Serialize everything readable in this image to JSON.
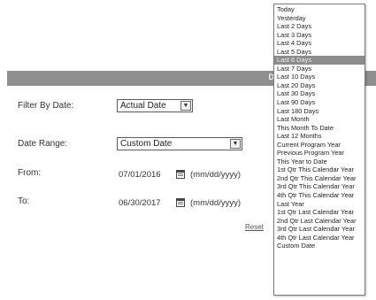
{
  "banner": {
    "text": "De"
  },
  "filter": {
    "filter_label": "Filter By Date:",
    "filter_value": "Actual Date",
    "range_label": "Date Range:",
    "range_value": "Custom Date",
    "from_label": "From:",
    "from_value": "07/01/2016",
    "to_label": "To:",
    "to_value": "06/30/2017",
    "date_hint": "(mm/dd/yyyy)",
    "reset_label": "Reset"
  },
  "dropdown": {
    "selected_index": 6,
    "options": [
      "Today",
      "Yesterday",
      "Last 2 Days",
      "Last 3 Days",
      "Last 4 Days",
      "Last 5 Days",
      "Last 6 Days",
      "Last 7 Days",
      "Last 10 Days",
      "Last 20 Days",
      "Last 30 Days",
      "Last 90 Days",
      "Last 180 Days",
      "Last Month",
      "This Month To Date",
      "Last 12 Months",
      "Current Program Year",
      "Previous Program Year",
      "This Year to Date",
      "1st Qtr This Calendar Year",
      "2nd Qtr This Calendar Year",
      "3rd Qtr This Calendar Year",
      "4th Qtr This Calendar Year",
      "Last Year",
      "1st Qtr Last Calendar Year",
      "2nd Qtr Last Calendar Year",
      "3rd Qtr Last Calendar Year",
      "4th Qtr Last Calendar Year",
      "Custom Date"
    ]
  },
  "icons": {
    "select_arrow": "chevron-down-icon",
    "date_picker": "calendar-icon"
  },
  "colors": {
    "banner": "#8f8f8f",
    "highlight": "#8c8c8c"
  }
}
